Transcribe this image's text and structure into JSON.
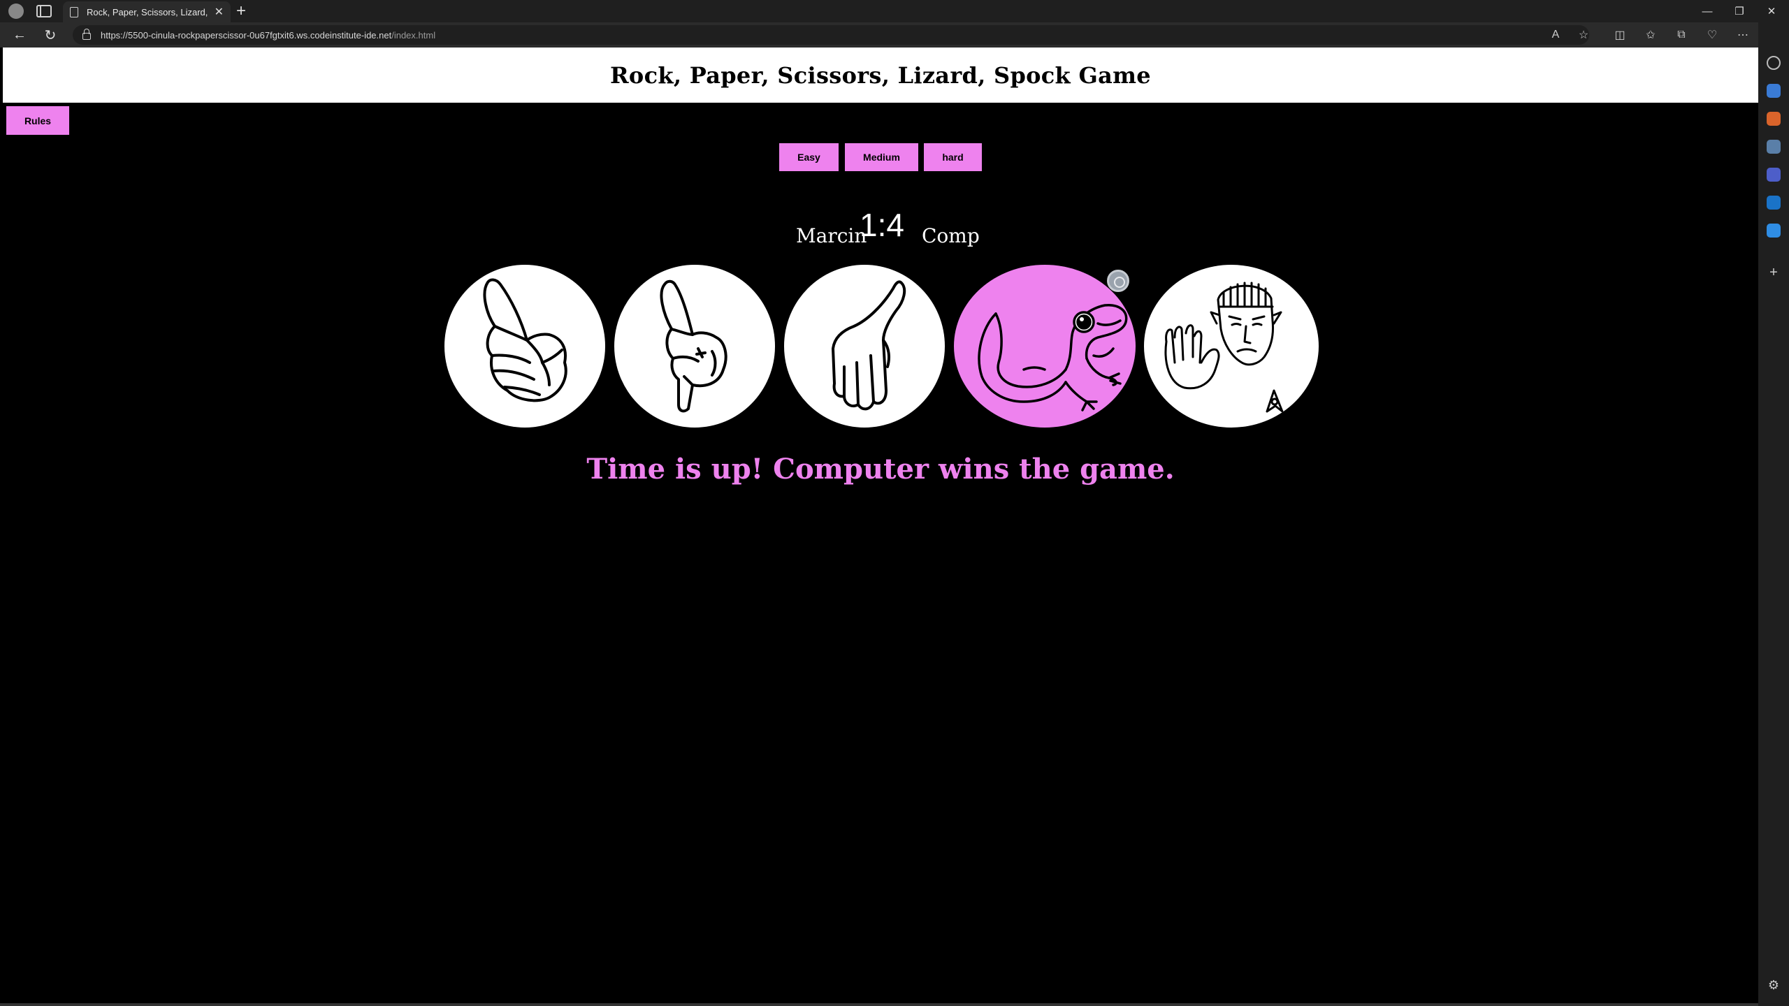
{
  "browser": {
    "tab_title": "Rock, Paper, Scissors, Lizard, Spo",
    "url_host": "https://5500-cinula-rockpaperscissor-0u67fgtxit6.ws.codeinstitute-ide.net",
    "url_path": "/index.html"
  },
  "page": {
    "title": "Rock, Paper, Scissors, Lizard, Spock Game",
    "rules_label": "Rules",
    "difficulty": {
      "easy": "Easy",
      "medium": "Medium",
      "hard": "hard"
    },
    "player_name": "Marcin",
    "score": "1:4",
    "computer_name": "Comp",
    "choices": [
      "rock",
      "paper",
      "scissors",
      "lizard",
      "spock"
    ],
    "selected_choice": "lizard",
    "result_message": "Time is up! Computer wins the game."
  },
  "colors": {
    "accent": "#ee82ee",
    "background": "#000000",
    "header_bg": "#ffffff"
  },
  "icons": {
    "rock": "fist-hand-icon",
    "paper": "pointing-hand-icon",
    "scissors": "flat-hand-icon",
    "lizard": "lizard-icon",
    "spock": "spock-salute-icon"
  }
}
